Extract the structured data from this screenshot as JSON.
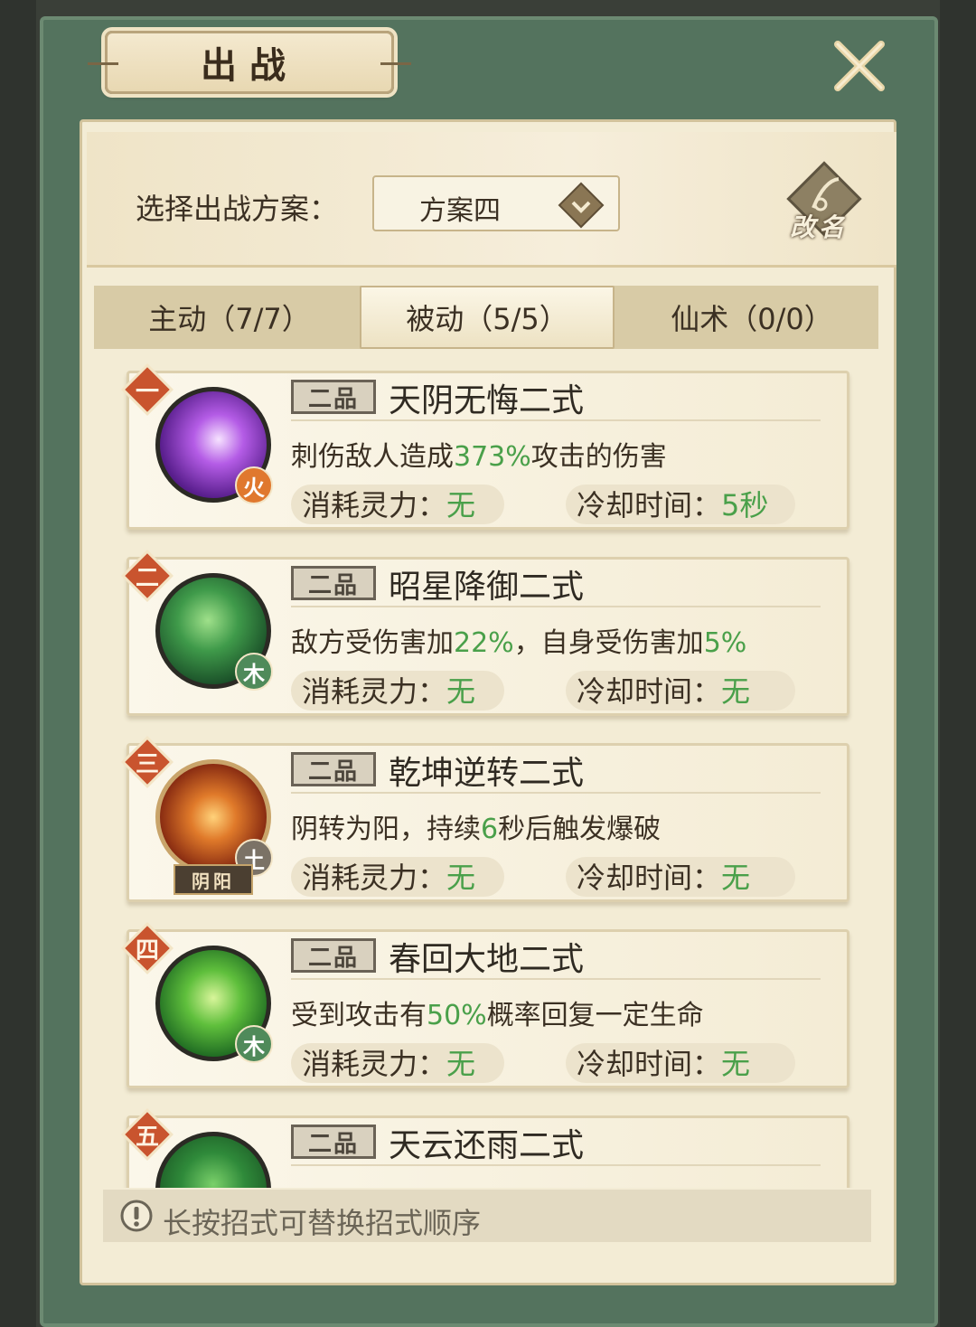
{
  "title": "出战",
  "plan": {
    "label": "选择出战方案：",
    "selected": "方案四",
    "rename": "改名"
  },
  "tabs": [
    {
      "label": "主动（7/7）",
      "active": false
    },
    {
      "label": "被动（5/5）",
      "active": true
    },
    {
      "label": "仙术（0/0）",
      "active": false
    }
  ],
  "skills": [
    {
      "rank": "一",
      "grade": "二品",
      "name": "天阴无悔二式",
      "desc_pre": "刺伤敌人造成",
      "desc_hl": "373%",
      "desc_post": "攻击的伤害",
      "desc_hl2": "",
      "desc_post2": "",
      "element": "火",
      "cost_label": "消耗灵力：",
      "cost_value": "无",
      "cd_label": "冷却时间：",
      "cd_value": "5秒"
    },
    {
      "rank": "二",
      "grade": "二品",
      "name": "昭星降御二式",
      "desc_pre": "敌方受伤害加",
      "desc_hl": "22%",
      "desc_post": "，自身受伤害加",
      "desc_hl2": "5%",
      "desc_post2": "",
      "element": "木",
      "cost_label": "消耗灵力：",
      "cost_value": "无",
      "cd_label": "冷却时间：",
      "cd_value": "无"
    },
    {
      "rank": "三",
      "grade": "二品",
      "name": "乾坤逆转二式",
      "desc_pre": "阴转为阳，持续",
      "desc_hl": "6",
      "desc_post": "秒后触发爆破",
      "desc_hl2": "",
      "desc_post2": "",
      "element": "土",
      "tag": "阴阳",
      "cost_label": "消耗灵力：",
      "cost_value": "无",
      "cd_label": "冷却时间：",
      "cd_value": "无"
    },
    {
      "rank": "四",
      "grade": "二品",
      "name": "春回大地二式",
      "desc_pre": "受到攻击有",
      "desc_hl": "50%",
      "desc_post": "概率回复一定生命",
      "desc_hl2": "",
      "desc_post2": "",
      "element": "木",
      "cost_label": "消耗灵力：",
      "cost_value": "无",
      "cd_label": "冷却时间：",
      "cd_value": "无"
    },
    {
      "rank": "五",
      "grade": "二品",
      "name": "天云还雨二式"
    }
  ],
  "tip": "长按招式可替换招式顺序",
  "colors": {
    "frame_green": "#54735e",
    "parchment": "#f3ecd5",
    "highlight_green": "#4aa04a",
    "badge_red": "#c9542e",
    "fire_orange": "#e0782e",
    "wood_green": "#4f8a5a",
    "earth_gray": "#7b7266"
  },
  "icons": {
    "close": "close-x-icon",
    "dropdown": "diamond-dropdown-icon",
    "rename": "scroll-quill-icon",
    "tip": "exclamation-icon"
  }
}
